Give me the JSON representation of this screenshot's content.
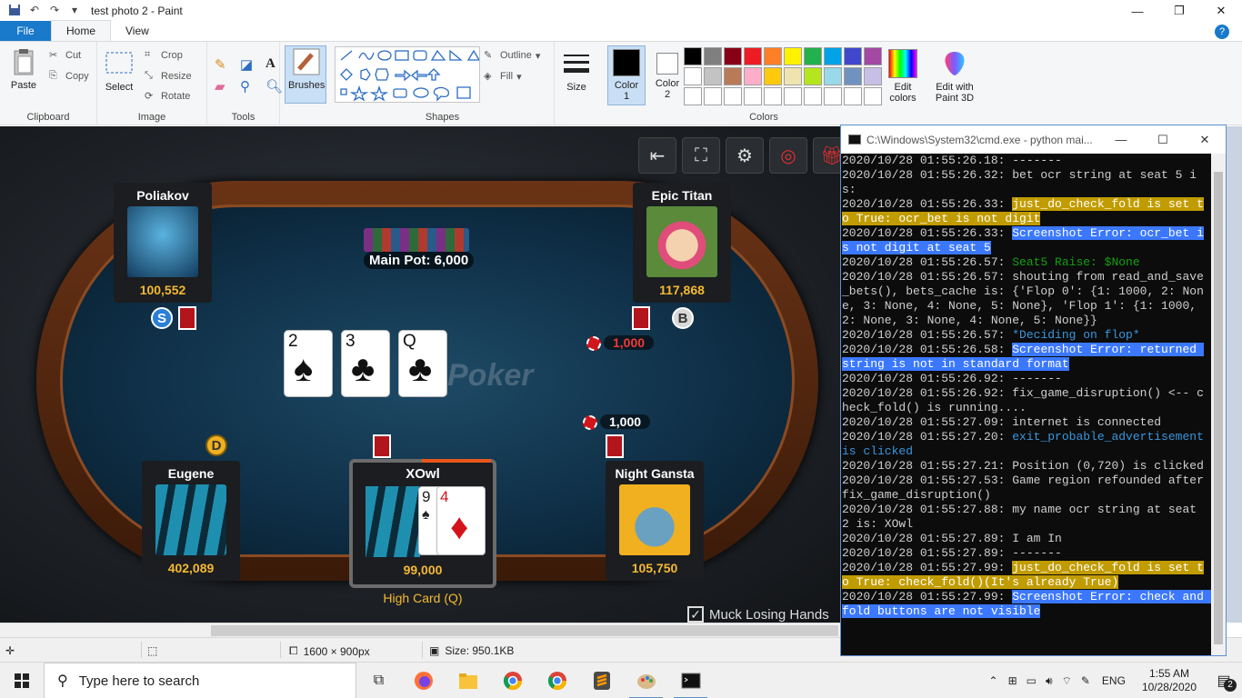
{
  "window": {
    "title": "test photo 2 - Paint",
    "minimize": "—",
    "maximize": "❐",
    "close": "✕"
  },
  "ribbon_tabs": [
    "File",
    "Home",
    "View"
  ],
  "ribbon": {
    "clipboard": {
      "paste": "Paste",
      "cut": "Cut",
      "copy": "Copy",
      "label": "Clipboard"
    },
    "image": {
      "select": "Select",
      "crop": "Crop",
      "resize": "Resize",
      "rotate": "Rotate",
      "label": "Image"
    },
    "tools": {
      "label": "Tools"
    },
    "brushes": "Brushes",
    "shapes": {
      "outline": "Outline",
      "fill": "Fill",
      "label": "Shapes"
    },
    "size": "Size",
    "color1": "Color 1",
    "color2": "Color 2",
    "colors_label": "Colors",
    "edit_colors": "Edit colors",
    "edit_paint3d": "Edit with Paint 3D",
    "palette": [
      "#000000",
      "#7f7f7f",
      "#880015",
      "#ed1c24",
      "#ff7f27",
      "#fff200",
      "#22b14c",
      "#00a2e8",
      "#3f48cc",
      "#a349a4",
      "#ffffff",
      "#c3c3c3",
      "#b97a57",
      "#ffaec9",
      "#ffc90e",
      "#efe4b0",
      "#b5e61d",
      "#99d9ea",
      "#7092be",
      "#c8bfe7",
      "#ffffff",
      "#ffffff",
      "#ffffff",
      "#ffffff",
      "#ffffff",
      "#ffffff",
      "#ffffff",
      "#ffffff",
      "#ffffff",
      "#ffffff"
    ]
  },
  "game": {
    "watermark": "Poker",
    "main_pot": "Main Pot: 6,000",
    "players": {
      "poliakov": {
        "name": "Poliakov",
        "stack": "100,552"
      },
      "epic_titan": {
        "name": "Epic Titan",
        "stack": "117,868"
      },
      "eugene": {
        "name": "Eugene",
        "stack": "402,089"
      },
      "xowl": {
        "name": "XOwl",
        "stack": "99,000",
        "hand": "High Card (Q)"
      },
      "night_gansta": {
        "name": "Night Gansta",
        "stack": "105,750"
      }
    },
    "board": [
      {
        "rank": "2",
        "suit": "♠"
      },
      {
        "rank": "3",
        "suit": "♣"
      },
      {
        "rank": "Q",
        "suit": "♣"
      }
    ],
    "hero_cards": [
      {
        "rank": "9",
        "suit": "♠"
      },
      {
        "rank": "4",
        "suit": "♦"
      }
    ],
    "bets": {
      "epic_titan": "1,000",
      "night_gansta": "1,000"
    },
    "badges": {
      "small_blind": "S",
      "big_blind": "B",
      "dealer": "D"
    },
    "muck": "Muck Losing Hands"
  },
  "status": {
    "dimensions": "1600 × 900px",
    "size": "Size: 950.1KB"
  },
  "cmd": {
    "title": "C:\\Windows\\System32\\cmd.exe - python  mai...",
    "lines": [
      {
        "t": "2020/10/28 01:55:26.18: -------"
      },
      {
        "t": "2020/10/28 01:55:26.32: bet ocr string at seat 5 is:"
      },
      {
        "p": "2020/10/28 01:55:26.33: ",
        "h": "just_do_check_fold is set to True: ocr_bet is not digit",
        "c": "yellow"
      },
      {
        "p": "2020/10/28 01:55:26.33: ",
        "h": "Screenshot Error: ocr_bet is not digit at seat 5",
        "c": "blue"
      },
      {
        "p": "2020/10/28 01:55:26.57: ",
        "h": "Seat5 Raise: $None",
        "c": "green"
      },
      {
        "t": "2020/10/28 01:55:26.57: shouting from read_and_save_bets(), bets_cache is: {'Flop 0': {1: 1000, 2: None, 3: None, 4: None, 5: None}, 'Flop 1': {1: 1000, 2: None, 3: None, 4: None, 5: None}}"
      },
      {
        "p": "2020/10/28 01:55:26.57: ",
        "h": "*Deciding on flop*",
        "c": "cyan"
      },
      {
        "p": "2020/10/28 01:55:26.58: ",
        "h": "Screenshot Error: returned string is not in standard format",
        "c": "blue"
      },
      {
        "t": "2020/10/28 01:55:26.92: -------"
      },
      {
        "t": "2020/10/28 01:55:26.92: fix_game_disruption() <-- check_fold() is running...."
      },
      {
        "t": "2020/10/28 01:55:27.09: internet is connected"
      },
      {
        "p": "2020/10/28 01:55:27.20: ",
        "h": "exit_probable_advertisement is clicked",
        "c": "cyan"
      },
      {
        "t": "2020/10/28 01:55:27.21: Position (0,720) is clicked"
      },
      {
        "t": "2020/10/28 01:55:27.53: Game region refounded after fix_game_disruption()"
      },
      {
        "t": "2020/10/28 01:55:27.88: my name ocr string at seat 2 is: XOwl"
      },
      {
        "t": "2020/10/28 01:55:27.89: I am In"
      },
      {
        "t": "2020/10/28 01:55:27.89: -------"
      },
      {
        "p": "2020/10/28 01:55:27.99: ",
        "h": "just_do_check_fold is set to True: check_fold()(It's already True)",
        "c": "yellow"
      },
      {
        "p": "2020/10/28 01:55:27.99: ",
        "h": "Screenshot Error: check and fold buttons are not visible",
        "c": "blue"
      }
    ]
  },
  "taskbar": {
    "search_placeholder": "Type here to search",
    "lang": "ENG",
    "time": "1:55 AM",
    "date": "10/28/2020",
    "notifications": "2"
  }
}
